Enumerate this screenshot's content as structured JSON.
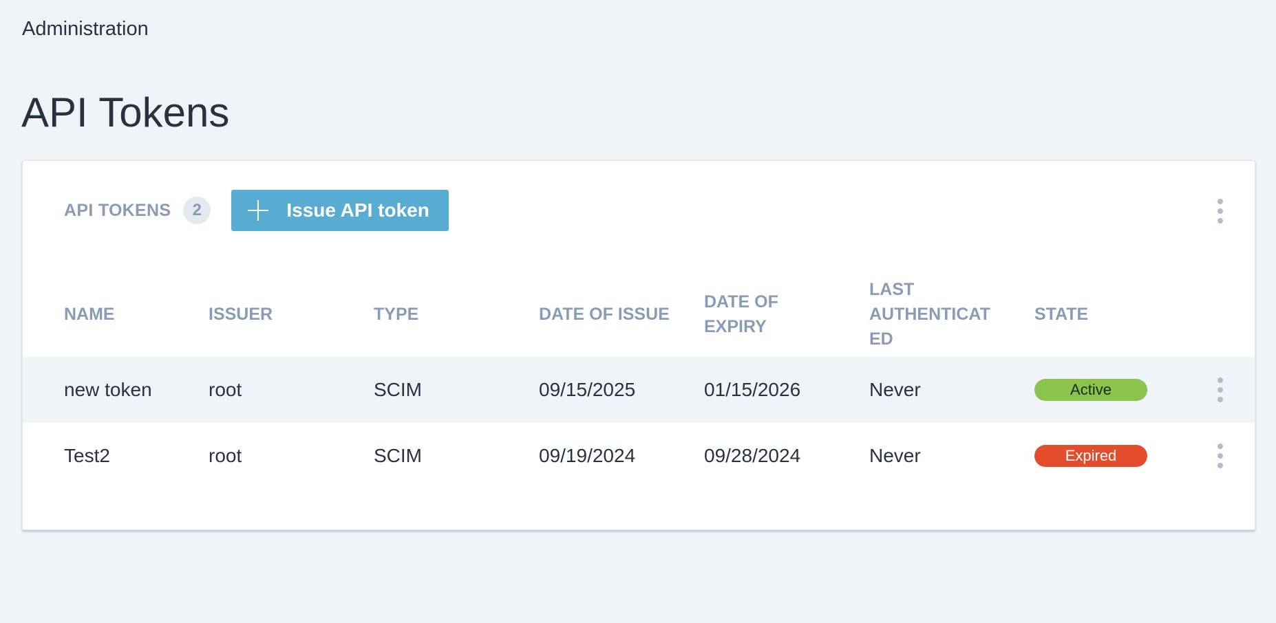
{
  "breadcrumb": "Administration",
  "page_title": "API Tokens",
  "card": {
    "section_label": "API TOKENS",
    "count": "2",
    "issue_button_label": "Issue API token"
  },
  "table": {
    "columns": {
      "name": "NAME",
      "issuer": "ISSUER",
      "type": "TYPE",
      "date_of_issue": "DATE OF ISSUE",
      "date_of_expiry_line1": "DATE OF",
      "date_of_expiry_line2": "EXPIRY",
      "last_auth_line1": "LAST",
      "last_auth_line2": "AUTHENTICAT",
      "last_auth_line3": "ED",
      "state": "STATE"
    },
    "rows": [
      {
        "name": "new token",
        "issuer": "root",
        "type": "SCIM",
        "date_of_issue": "09/15/2025",
        "date_of_expiry": "01/15/2026",
        "last_authenticated": "Never",
        "state": "Active"
      },
      {
        "name": "Test2",
        "issuer": "root",
        "type": "SCIM",
        "date_of_issue": "09/19/2024",
        "date_of_expiry": "09/28/2024",
        "last_authenticated": "Never",
        "state": "Expired"
      }
    ]
  },
  "colors": {
    "background": "#f0f3f8",
    "primary_button": "#58acd2",
    "active_state": "#8bc34f",
    "expired_state": "#e34d2c",
    "muted_text": "#8a9cb3"
  },
  "icons": {
    "issue_button": "plus-icon",
    "menus": "kebab-menu-icon"
  }
}
